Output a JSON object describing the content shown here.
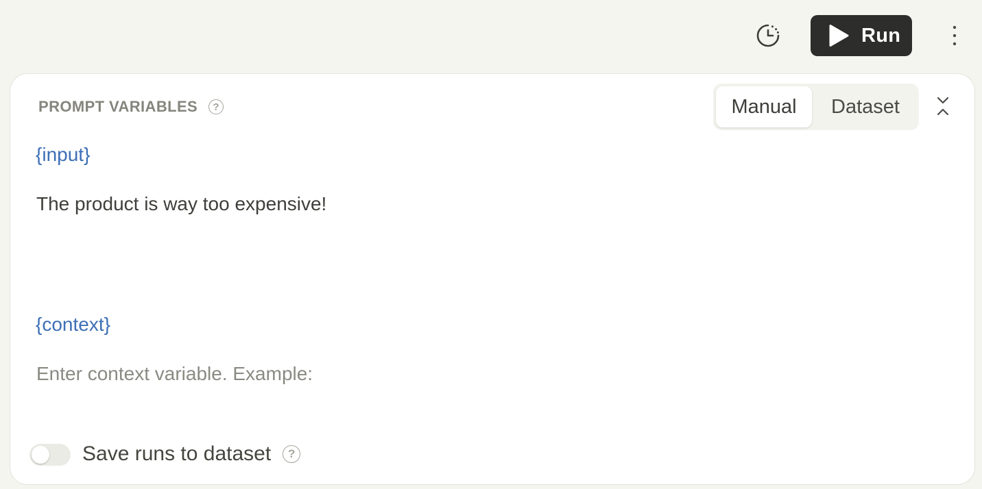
{
  "toolbar": {
    "history_icon": "history-clock-icon",
    "run_label": "Run",
    "run_icon": "play-icon",
    "more_icon": "more-vertical-icon"
  },
  "panel": {
    "title": "PROMPT VARIABLES",
    "help_icon": "help-circle-icon",
    "modes": [
      {
        "label": "Manual",
        "selected": true
      },
      {
        "label": "Dataset",
        "selected": false
      }
    ],
    "collapse_icon": "collapse-icon",
    "variables": [
      {
        "name": "{input}",
        "value": "The product is way too expensive!",
        "placeholder": ""
      },
      {
        "name": "{context}",
        "value": "",
        "placeholder": "Enter context variable. Example:"
      }
    ],
    "save_runs": {
      "label": "Save runs to dataset",
      "enabled": false
    }
  },
  "colors": {
    "background": "#f5f5f0",
    "run_button": "#2d2d2b",
    "variable_name": "#3d6fb6",
    "muted_text": "#85857d"
  }
}
